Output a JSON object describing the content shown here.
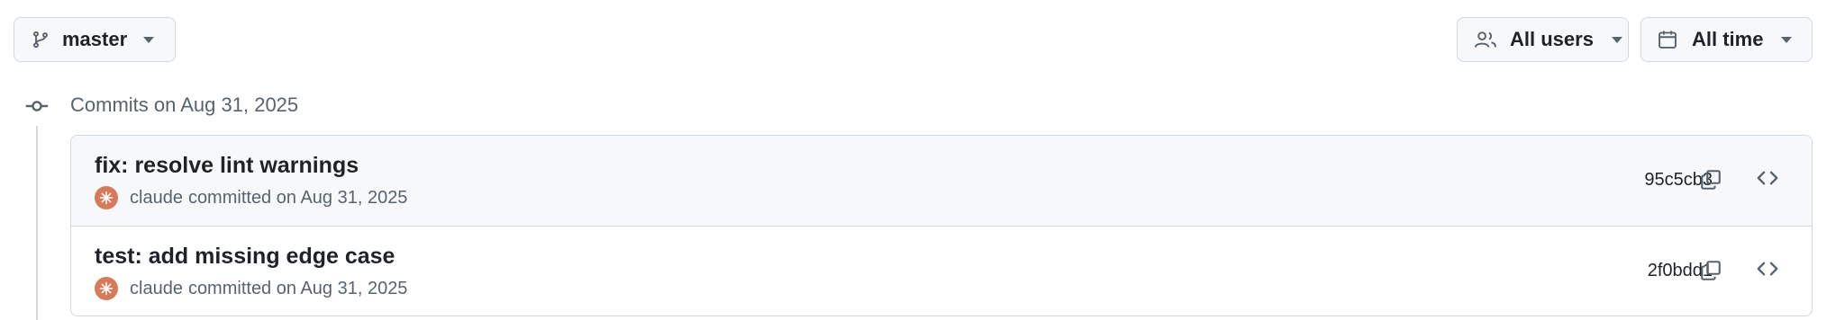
{
  "toolbar": {
    "branch_label": "master",
    "users_label": "All users",
    "time_label": "All time"
  },
  "group": {
    "title": "Commits on Aug 31, 2025"
  },
  "commits": [
    {
      "title": "fix: resolve lint warnings",
      "author": "claude",
      "committed": "committed on Aug 31, 2025",
      "sha": "95c5cb3"
    },
    {
      "title": "test: add missing edge case",
      "author": "claude",
      "committed": "committed on Aug 31, 2025",
      "sha": "2f0bdd1"
    }
  ],
  "icons": {
    "branch": "git-branch-icon",
    "users": "people-icon",
    "time": "calendar-icon",
    "group": "git-commit-icon",
    "copy": "copy-icon",
    "browse": "code-icon"
  },
  "colors": {
    "avatar": "#d87a5a",
    "border": "#d1d9e0",
    "muted_text": "#59636e"
  }
}
